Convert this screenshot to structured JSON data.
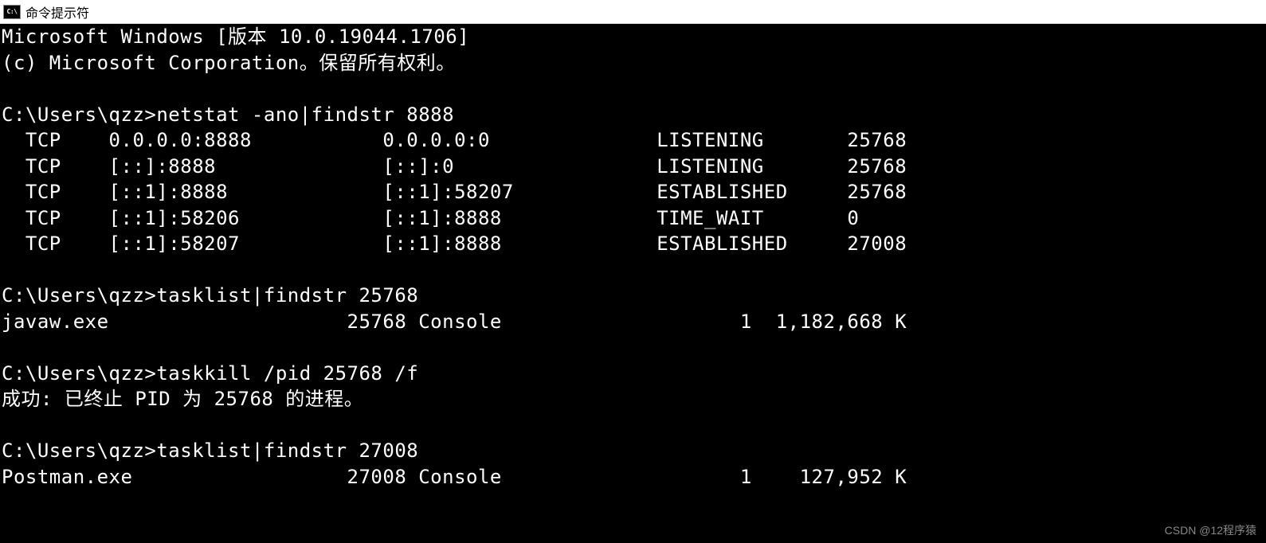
{
  "window": {
    "title": "命令提示符",
    "icon_label": "C:\\"
  },
  "terminal": {
    "lines": [
      "Microsoft Windows [版本 10.0.19044.1706]",
      "(c) Microsoft Corporation。保留所有权利。",
      "",
      "C:\\Users\\qzz>netstat -ano|findstr 8888",
      "  TCP    0.0.0.0:8888           0.0.0.0:0              LISTENING       25768",
      "  TCP    [::]:8888              [::]:0                 LISTENING       25768",
      "  TCP    [::1]:8888             [::1]:58207            ESTABLISHED     25768",
      "  TCP    [::1]:58206            [::1]:8888             TIME_WAIT       0",
      "  TCP    [::1]:58207            [::1]:8888             ESTABLISHED     27008",
      "",
      "C:\\Users\\qzz>tasklist|findstr 25768",
      "javaw.exe                    25768 Console                    1  1,182,668 K",
      "",
      "C:\\Users\\qzz>taskkill /pid 25768 /f",
      "成功: 已终止 PID 为 25768 的进程。",
      "",
      "C:\\Users\\qzz>tasklist|findstr 27008",
      "Postman.exe                  27008 Console                    1    127,952 K"
    ]
  },
  "watermark": "CSDN @12程序猿"
}
